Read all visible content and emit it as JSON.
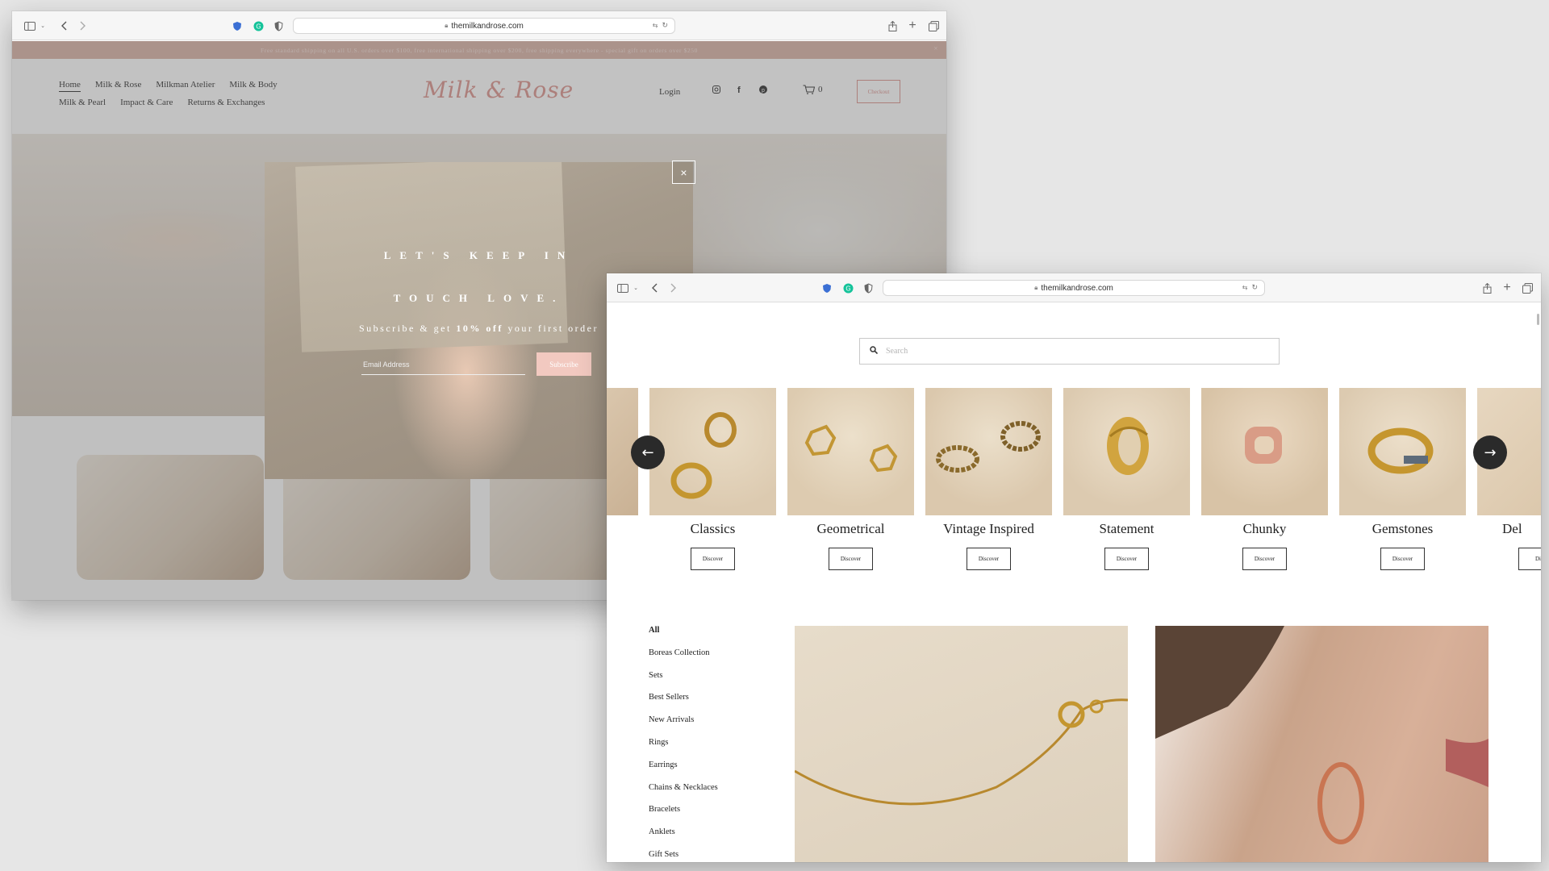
{
  "window_back": {
    "url": "themilkandrose.com",
    "banner": "Free standard shipping on all U.S. orders over $100, free international shipping over $200, free shipping everywhere - special gift on orders over $250",
    "nav": {
      "row1": [
        "Home",
        "Milk & Rose",
        "Milkman Atelier",
        "Milk & Body"
      ],
      "row2": [
        "Milk & Pearl",
        "Impact & Care",
        "Returns & Exchanges"
      ]
    },
    "logo": "Milk & Rose",
    "login": "Login",
    "cart_count": "0",
    "checkout": "Checkout",
    "popup": {
      "title_line1": "LET'S KEEP IN",
      "title_line2": "TOUCH LOVE.",
      "subtitle_pre": "Subscribe & get",
      "subtitle_bold": "10% off",
      "subtitle_post": "your first order",
      "email_placeholder": "Email Address",
      "subscribe": "Subscribe",
      "close": "×"
    }
  },
  "window_front": {
    "url": "themilkandrose.com",
    "search_placeholder": "Search",
    "categories": [
      {
        "name": "Classics",
        "button": "Discover"
      },
      {
        "name": "Geometrical",
        "button": "Discover"
      },
      {
        "name": "Vintage Inspired",
        "button": "Discover"
      },
      {
        "name": "Statement",
        "button": "Discover"
      },
      {
        "name": "Chunky",
        "button": "Discover"
      },
      {
        "name": "Gemstones",
        "button": "Discover"
      },
      {
        "name": "Del",
        "button": "Di"
      }
    ],
    "sidebar": [
      "All",
      "Boreas Collection",
      "Sets",
      "Best Sellers",
      "New Arrivals",
      "Rings",
      "Earrings",
      "Chains & Necklaces",
      "Bracelets",
      "Anklets",
      "Gift Sets"
    ],
    "colors": {
      "accent": "#d98c86",
      "banner": "#d8aea0",
      "tile_bg": "#dcc8ab"
    }
  }
}
